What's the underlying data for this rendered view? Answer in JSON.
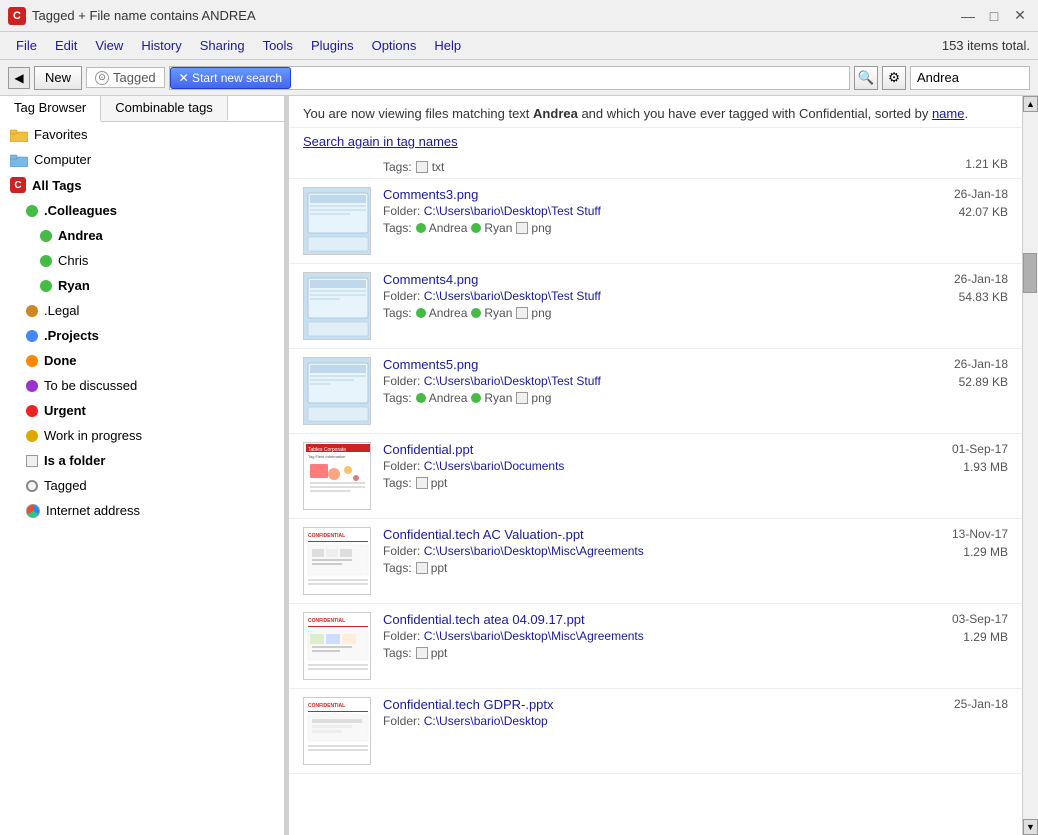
{
  "titleBar": {
    "icon": "C",
    "title": "Tagged  +  File name contains ANDREA",
    "controls": {
      "minimize": "—",
      "maximize": "□",
      "close": "✕"
    }
  },
  "menuBar": {
    "items": [
      "File",
      "Edit",
      "View",
      "History",
      "Sharing",
      "Tools",
      "Plugins",
      "Options",
      "Help"
    ],
    "itemCount": "153 items total."
  },
  "toolbar": {
    "back": "◀",
    "new": "New",
    "taggedLabel": "Tagged",
    "startNewSearch": "✕  Start new search",
    "searchValue": "Andrea"
  },
  "sidebar": {
    "tabs": [
      "Tag Browser",
      "Combinable tags"
    ],
    "activeTab": "Tag Browser",
    "items": [
      {
        "id": "favorites",
        "label": "Favorites",
        "icon": "folder-favorites",
        "indent": 0
      },
      {
        "id": "computer",
        "label": "Computer",
        "icon": "folder-computer",
        "indent": 0
      },
      {
        "id": "all-tags",
        "label": "All Tags",
        "icon": "all-tags-red",
        "indent": 0
      },
      {
        "id": "colleagues",
        "label": ".Colleagues",
        "icon": "dot-green",
        "indent": 1,
        "bold": true
      },
      {
        "id": "andrea",
        "label": "Andrea",
        "icon": "dot-green",
        "indent": 2
      },
      {
        "id": "chris",
        "label": "Chris",
        "icon": "dot-green",
        "indent": 2
      },
      {
        "id": "ryan",
        "label": "Ryan",
        "icon": "dot-green",
        "indent": 2,
        "bold": true
      },
      {
        "id": "legal",
        "label": ".Legal",
        "icon": "dot-orange",
        "indent": 1
      },
      {
        "id": "projects",
        "label": ".Projects",
        "icon": "dot-blue",
        "indent": 1,
        "bold": true
      },
      {
        "id": "done",
        "label": "Done",
        "icon": "dot-orange-dark",
        "indent": 1,
        "bold": true
      },
      {
        "id": "to-be-discussed",
        "label": "To be discussed",
        "icon": "dot-purple",
        "indent": 1
      },
      {
        "id": "urgent",
        "label": "Urgent",
        "icon": "dot-red",
        "indent": 1,
        "bold": true
      },
      {
        "id": "work-in-progress",
        "label": "Work in progress",
        "icon": "dot-yellow",
        "indent": 1
      },
      {
        "id": "is-a-folder",
        "label": "Is a folder",
        "icon": "box-white",
        "indent": 1,
        "bold": true
      },
      {
        "id": "tagged",
        "label": "Tagged",
        "icon": "dot-gray-circle",
        "indent": 1
      },
      {
        "id": "internet-address",
        "label": "Internet address",
        "icon": "dot-cyan-multi",
        "indent": 1
      }
    ]
  },
  "content": {
    "descriptionPre": "You are now viewing files matching text ",
    "highlight": "Andrea",
    "descriptionMid": "  and  which you have ever tagged with Confidential, sorted by ",
    "sortLink": "name",
    "descriptionPost": ".",
    "searchAgainLink": "Search again in tag names",
    "files": [
      {
        "name": "Comments3.png",
        "folder": "C:\\Users\\bario\\Desktop\\Test Stuff",
        "tags": [
          {
            "type": "dot",
            "color": "#44bb44",
            "label": "Andrea"
          },
          {
            "type": "dot",
            "color": "#44bb44",
            "label": "Ryan"
          },
          {
            "type": "box",
            "label": "png"
          }
        ],
        "date": "26-Jan-18",
        "size": "42.07 KB",
        "thumbType": "screenshot"
      },
      {
        "name": "Comments4.png",
        "folder": "C:\\Users\\bario\\Desktop\\Test Stuff",
        "tags": [
          {
            "type": "dot",
            "color": "#44bb44",
            "label": "Andrea"
          },
          {
            "type": "dot",
            "color": "#44bb44",
            "label": "Ryan"
          },
          {
            "type": "box",
            "label": "png"
          }
        ],
        "date": "26-Jan-18",
        "size": "54.83 KB",
        "thumbType": "screenshot"
      },
      {
        "name": "Comments5.png",
        "folder": "C:\\Users\\bario\\Desktop\\Test Stuff",
        "tags": [
          {
            "type": "dot",
            "color": "#44bb44",
            "label": "Andrea"
          },
          {
            "type": "dot",
            "color": "#44bb44",
            "label": "Ryan"
          },
          {
            "type": "box",
            "label": "png"
          }
        ],
        "date": "26-Jan-18",
        "size": "52.89 KB",
        "thumbType": "screenshot"
      },
      {
        "name": "Confidential.ppt",
        "folder": "C:\\Users\\bario\\Documents",
        "tags": [
          {
            "type": "box",
            "label": "ppt"
          }
        ],
        "date": "01-Sep-17",
        "size": "1.93 MB",
        "thumbType": "ppt-tables"
      },
      {
        "name": "Confidential.tech AC Valuation-.ppt",
        "folder": "C:\\Users\\bario\\Desktop\\Misc\\Agreements",
        "tags": [
          {
            "type": "box",
            "label": "ppt"
          }
        ],
        "date": "13-Nov-17",
        "size": "1.29 MB",
        "thumbType": "ppt-conf"
      },
      {
        "name": "Confidential.tech atea 04.09.17.ppt",
        "folder": "C:\\Users\\bario\\Desktop\\Misc\\Agreements",
        "tags": [
          {
            "type": "box",
            "label": "ppt"
          }
        ],
        "date": "03-Sep-17",
        "size": "1.29 MB",
        "thumbType": "ppt-conf"
      },
      {
        "name": "Confidential.tech GDPR-.pptx",
        "folder": "C:\\Users\\bario\\Desktop",
        "tags": [],
        "date": "25-Jan-18",
        "size": "",
        "thumbType": "ppt-conf"
      }
    ],
    "topFileTags": "txt",
    "topFileSize": "1.21 KB"
  }
}
